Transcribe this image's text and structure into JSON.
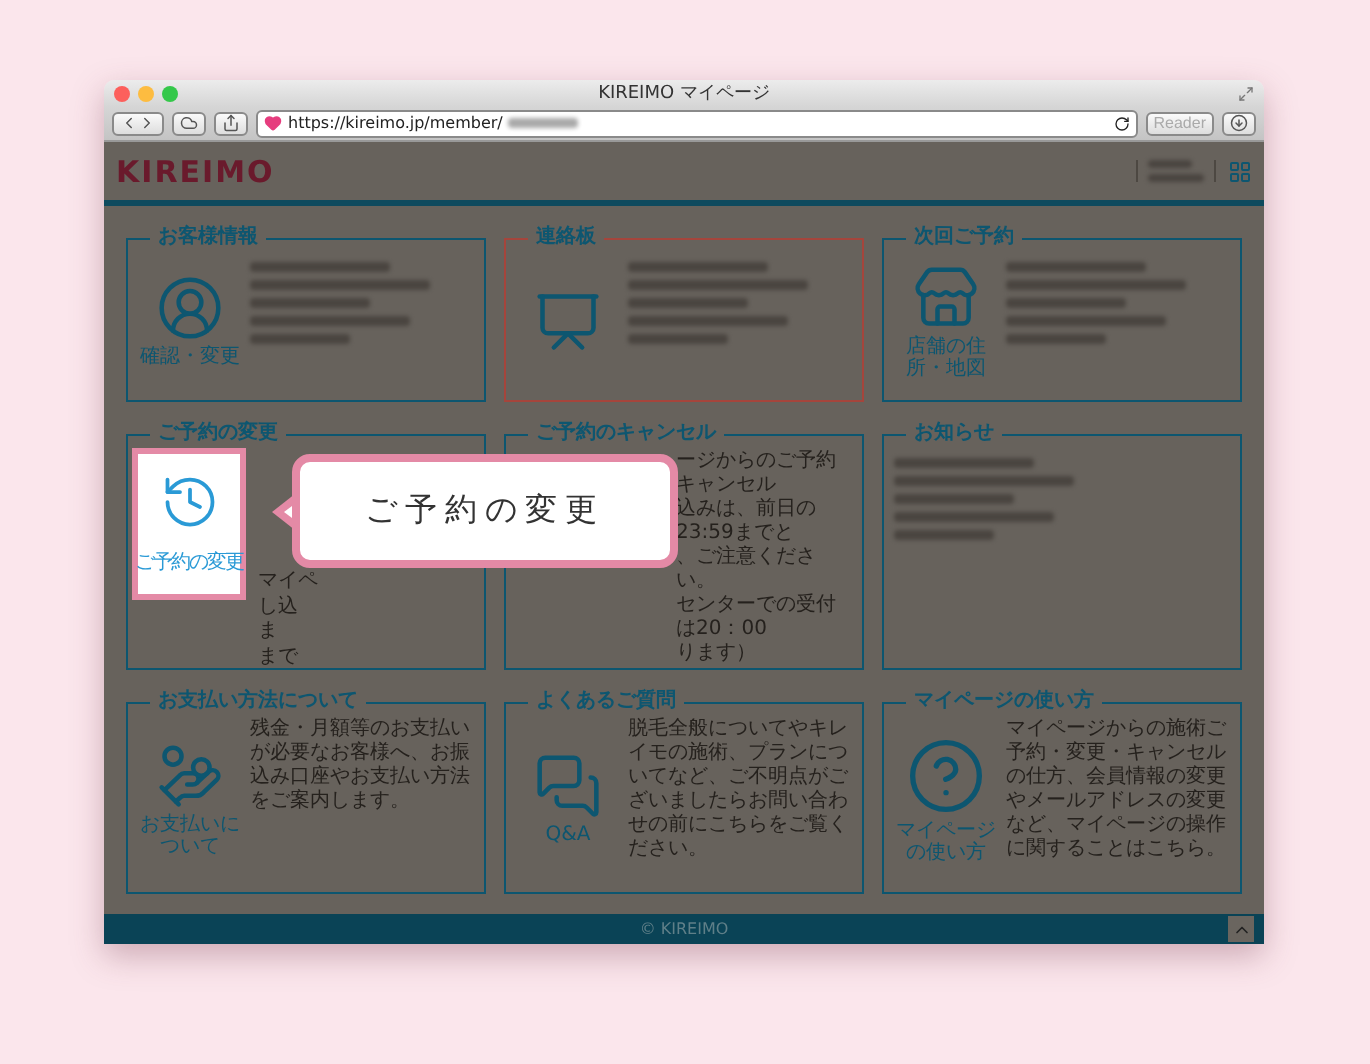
{
  "window": {
    "title": "KIREIMO マイページ",
    "url": "https://kireimo.jp/member/",
    "reader": "Reader"
  },
  "header": {
    "logo": "KIREIMO"
  },
  "cards": [
    {
      "title": "お客様情報",
      "kind": "person",
      "alert": false,
      "icon_label": "確認・変更",
      "redacted": true
    },
    {
      "title": "連絡板",
      "kind": "board",
      "alert": true,
      "redacted": true
    },
    {
      "title": "次回ご予約",
      "kind": "shop",
      "alert": false,
      "icon_label": "店舗の住所・地図",
      "redacted": true
    },
    {
      "title": "ご予約の変更",
      "kind": "covered",
      "alert": false,
      "lines": [
        "マイペ",
        "し込",
        "ま",
        "まで"
      ]
    },
    {
      "title": "ご予約のキャンセル",
      "kind": "none",
      "alert": false,
      "lines": [
        "ージからのご予約キャンセル",
        "込みは、前日の23:59までと",
        "、ご注意ください。",
        "センターでの受付は20：00",
        "ります）"
      ]
    },
    {
      "title": "お知らせ",
      "kind": "notice",
      "alert": false,
      "redacted": true
    },
    {
      "title": "お支払い方法について",
      "kind": "payment",
      "alert": false,
      "icon_label": "お支払いについて",
      "text": "残金・月額等のお支払いが必要なお客様へ、お振込み口座やお支払い方法をご案内します。"
    },
    {
      "title": "よくあるご質問",
      "kind": "qa",
      "alert": false,
      "icon_label": "Q&A",
      "text": "脱毛全般についてやキレイモの施術、プランについてなど、ご不明点がございましたらお問い合わせの前にこちらをご覧ください。"
    },
    {
      "title": "マイページの使い方",
      "kind": "question",
      "alert": false,
      "icon_label": "マイページの使い方",
      "text": "マイページからの施術ご予約・変更・キャンセルの仕方、会員情報の変更やメールアドレスの変更など、マイページの操作に関することはこちら。"
    }
  ],
  "highlight_tile": {
    "label": "ご予約の変更"
  },
  "callout": {
    "text": "ご予約の変更"
  },
  "footer": {
    "copyright": "© KIREIMO"
  }
}
